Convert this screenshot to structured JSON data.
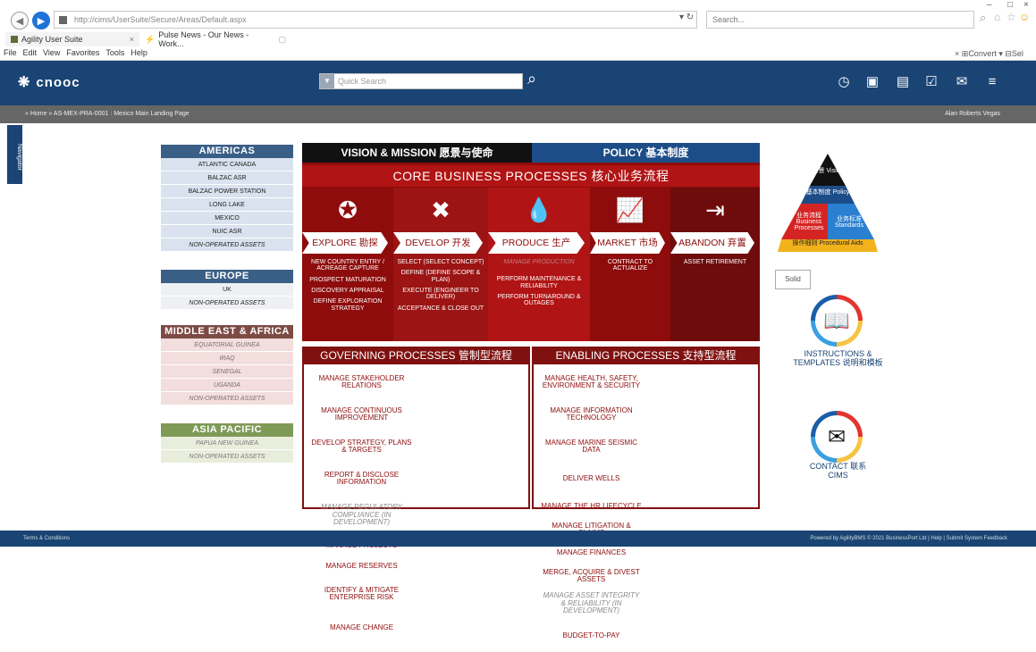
{
  "browser": {
    "address": "http://cims/UserSuite/Secure/Areas/Default.aspx",
    "search_placeholder": "Search...",
    "tabs": [
      {
        "label": "Agility User Suite"
      },
      {
        "label": "Pulse News - Our News - Work..."
      }
    ],
    "menu": [
      "File",
      "Edit",
      "View",
      "Favorites",
      "Tools",
      "Help"
    ],
    "convert_label": "Convert",
    "select_label": "Sel"
  },
  "app": {
    "logo_text": "cnooc",
    "quick_search_placeholder": "Quick Search",
    "breadcrumb": "» Home » AS-MEX-PRA-0001 : Mexico Main Landing Page",
    "user": "Alan Roberts Vegas",
    "navigator": "Navigator"
  },
  "regions": [
    {
      "key": "am",
      "title": "AMERICAS",
      "items": [
        "ATLANTIC CANADA",
        "BALZAC ASR",
        "BALZAC POWER STATION",
        "LONG LAKE",
        "MEXICO",
        "NUIC ASR"
      ],
      "op": "NON-OPERATED ASSETS"
    },
    {
      "key": "eu",
      "title": "EUROPE",
      "items": [
        "UK"
      ],
      "op": "NON-OPERATED ASSETS"
    },
    {
      "key": "me",
      "title": "MIDDLE EAST & AFRICA",
      "items": [
        "EQUATORIAL GUINEA",
        "IRAQ",
        "SENEGAL",
        "UGANDA"
      ],
      "op": "NON-OPERATED ASSETS"
    },
    {
      "key": "ap",
      "title": "ASIA PACIFIC",
      "items": [
        "PAPUA NEW GUINEA"
      ],
      "op": "NON-OPERATED ASSETS"
    }
  ],
  "main": {
    "vision": "VISION & MISSION 愿景与使命",
    "policy": "POLICY 基本制度",
    "core": "CORE BUSINESS PROCESSES 核心业务流程",
    "columns": [
      {
        "icon": "compass-icon",
        "glyph": "✪",
        "label": "EXPLORE 勘探",
        "bg": "#8e0c0c",
        "items": [
          "NEW COUNTRY ENTRY / ACREAGE CAPTURE",
          "PROSPECT MATURATION",
          "DISCOVERY APPRAISAL",
          "DEFINE EXPLORATION STRATEGY"
        ]
      },
      {
        "icon": "tools-icon",
        "glyph": "✖",
        "label": "DEVELOP 开发",
        "bg": "#9c1414",
        "items": [
          "SELECT (SELECT CONCEPT)",
          "DEFINE (DEFINE SCOPE & PLAN)",
          "EXECUTE (ENGINEER TO DELIVER)",
          "ACCEPTANCE & CLOSE OUT"
        ]
      },
      {
        "icon": "drop-icon",
        "glyph": "💧",
        "label": "PRODUCE 生产",
        "bg": "#b11414",
        "items": [
          "MANAGE PRODUCTION",
          "PERFORM MAINTENANCE & RELIABILITY",
          "PERFORM TURNAROUND & OUTAGES"
        ]
      },
      {
        "icon": "chart-icon",
        "glyph": "📈",
        "label": "MARKET 市场",
        "bg": "#8e0c0c",
        "items": [
          "CONTRACT TO ACTUALIZE"
        ]
      },
      {
        "icon": "exit-icon",
        "glyph": "⇥",
        "label": "ABANDON 弃置",
        "bg": "#6e0c0c",
        "items": [
          "ASSET RETIREMENT"
        ]
      }
    ],
    "governing": "GOVERNING PROCESSES 管制型流程",
    "enabling": "ENABLING PROCESSES 支持型流程",
    "governing_items": [
      "MANAGE STAKEHOLDER RELATIONS",
      "MANAGE CONTINUOUS IMPROVEMENT",
      "DEVELOP STRATEGY, PLANS & TARGETS",
      "REPORT & DISCLOSE INFORMATION",
      "MANAGE REGULATORY COMPLIANCE (IN DEVELOPMENT)",
      "MANAGE PROJECTS",
      "",
      "MANAGE RESERVES",
      "IDENTIFY & MITIGATE ENTERPRISE RISK",
      "MANAGE CHANGE"
    ],
    "enabling_items": [
      "MANAGE HEALTH, SAFETY, ENVIRONMENT & SECURITY",
      "MANAGE INFORMATION TECHNOLOGY",
      "MANAGE MARINE SEISMIC DATA",
      "DELIVER WELLS",
      "MANAGE THE HR LIFECYCLE",
      "MANAGE LITIGATION & CLAIMS",
      "MANAGE FINANCES",
      "MERGE, ACQUIRE & DIVEST ASSETS",
      "MANAGE ASSET INTEGRITY & RELIABILITY (IN DEVELOPMENT)",
      "BUDGET-TO-PAY"
    ]
  },
  "pyramid": {
    "vision": "愿景 Vision",
    "policy": "基本制度 Policy",
    "business": "业务流程 Business Processes",
    "standards": "业务标准 Standards",
    "aids": "操作细则 Procedural Aids"
  },
  "side": {
    "solid": "Solid",
    "instructions": "INSTRUCTIONS & TEMPLATES 说明和模板",
    "contact": "CONTACT 联系 CIMS"
  },
  "footer": {
    "left": "Terms & Conditions",
    "right": "Powered by AgilityBMS © 2021 BusinessPort Ltd  |  Help  |  Submit System Feedback"
  }
}
